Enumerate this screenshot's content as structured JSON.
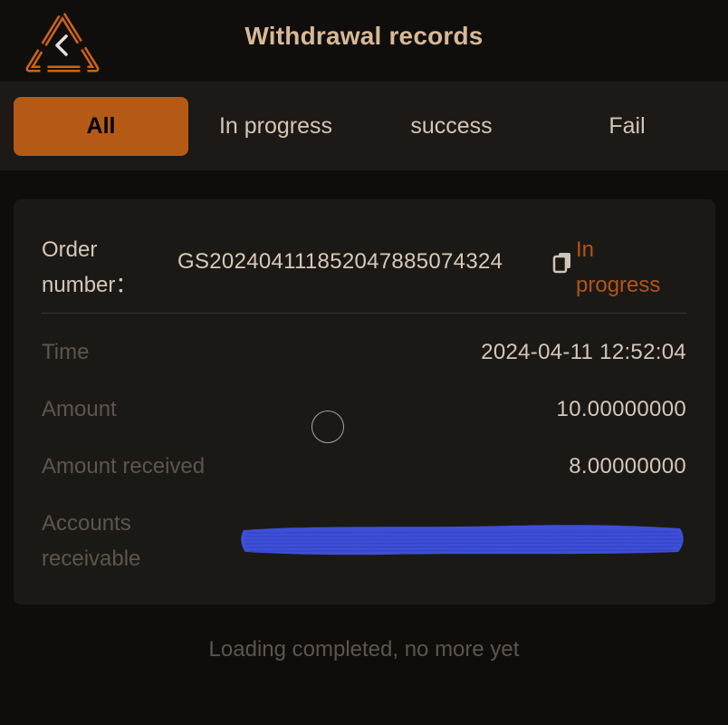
{
  "header": {
    "title": "Withdrawal records",
    "back_icon": "back-chevron-icon"
  },
  "tabs": [
    {
      "label": "All",
      "active": true
    },
    {
      "label": "In progress",
      "active": false
    },
    {
      "label": "success",
      "active": false
    },
    {
      "label": "Fail",
      "active": false
    }
  ],
  "record": {
    "order_label_line1": "Order",
    "order_label_line2": "number：",
    "order_number": "GS20240411185204788507432​4",
    "status_line1": "In",
    "status_line2": "progress",
    "time_label": "Time",
    "time_value": "2024-04-11 12:52:04",
    "amount_label": "Amount",
    "amount_value": "10.00000000",
    "amount_received_label": "Amount received",
    "amount_received_value": "8.00000000",
    "accounts_receivable_label_line1": "Accounts",
    "accounts_receivable_label_line2": "receivable"
  },
  "footer": {
    "note": "Loading completed, no more yet"
  },
  "colors": {
    "accent": "#b55a14",
    "status": "#b1541a",
    "redaction": "#3e4fd6"
  }
}
